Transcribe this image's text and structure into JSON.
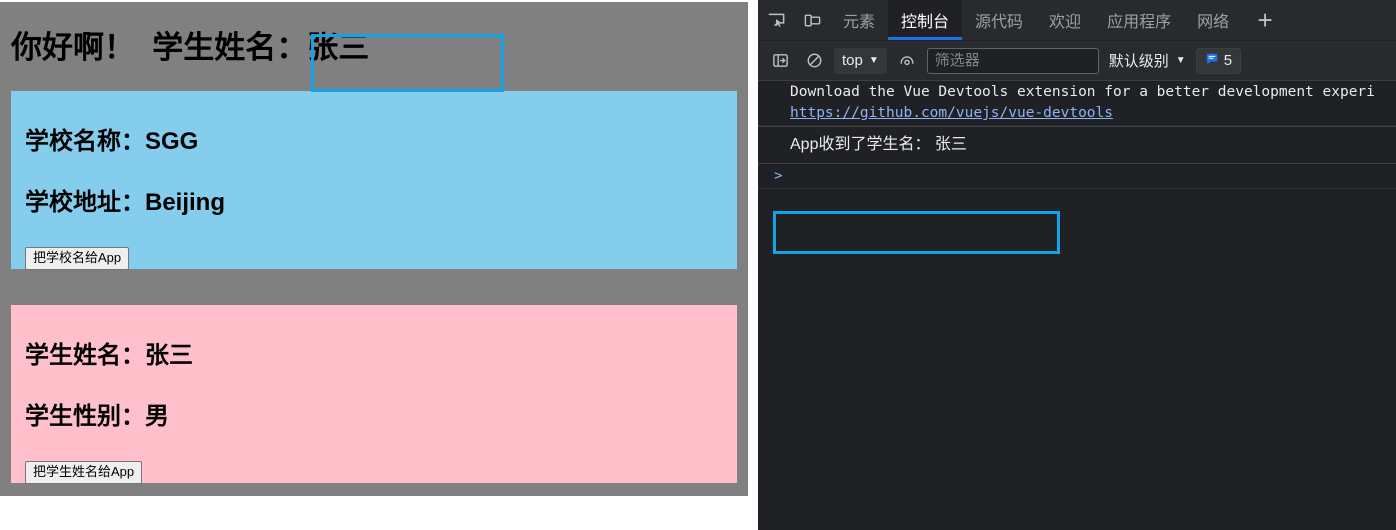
{
  "page": {
    "header": {
      "greeting": "你好啊！",
      "label": "学生姓名",
      "separator": "：",
      "value": "张三"
    },
    "school_card": {
      "name_label": "学校名称：",
      "name_value": "SGG",
      "address_label": "学校地址：",
      "address_value": "Beijing",
      "button_label": "把学校名给App",
      "bg_color": "#85CDEC"
    },
    "student_card": {
      "name_label": "学生姓名：",
      "name_value": "张三",
      "gender_label": "学生性别：",
      "gender_value": "男",
      "button_label": "把学生姓名给App",
      "bg_color": "#FFC0CB"
    },
    "container_bg": "#808080",
    "highlight_color": "#12A3E8"
  },
  "devtools": {
    "tabs": [
      {
        "label": "元素",
        "active": false
      },
      {
        "label": "控制台",
        "active": true
      },
      {
        "label": "源代码",
        "active": false
      },
      {
        "label": "欢迎",
        "active": false
      },
      {
        "label": "应用程序",
        "active": false
      },
      {
        "label": "网络",
        "active": false
      }
    ],
    "add_tab_label": "+",
    "icons": {
      "inspect": "inspect-element-icon",
      "device": "device-toolbar-icon",
      "sidebar": "console-sidebar-icon",
      "clear": "clear-console-icon",
      "eye": "live-expression-icon",
      "message_badge": "message-bubble-icon"
    },
    "console_bar": {
      "context_value": "top",
      "filter_placeholder": "筛选器",
      "filter_value": "",
      "level_label": "默认级别",
      "badge_count": "5",
      "caret": "▼"
    },
    "console_messages": [
      {
        "type": "info",
        "text": "Download the Vue Devtools extension for a better development experi",
        "link": "https://github.com/vuejs/vue-devtools"
      },
      {
        "type": "log",
        "text": "App收到了学生名： 张三",
        "highlighted": true
      }
    ],
    "prompt_symbol": ">",
    "bg_color": "#202124",
    "accent_color": "#1a73e8"
  }
}
